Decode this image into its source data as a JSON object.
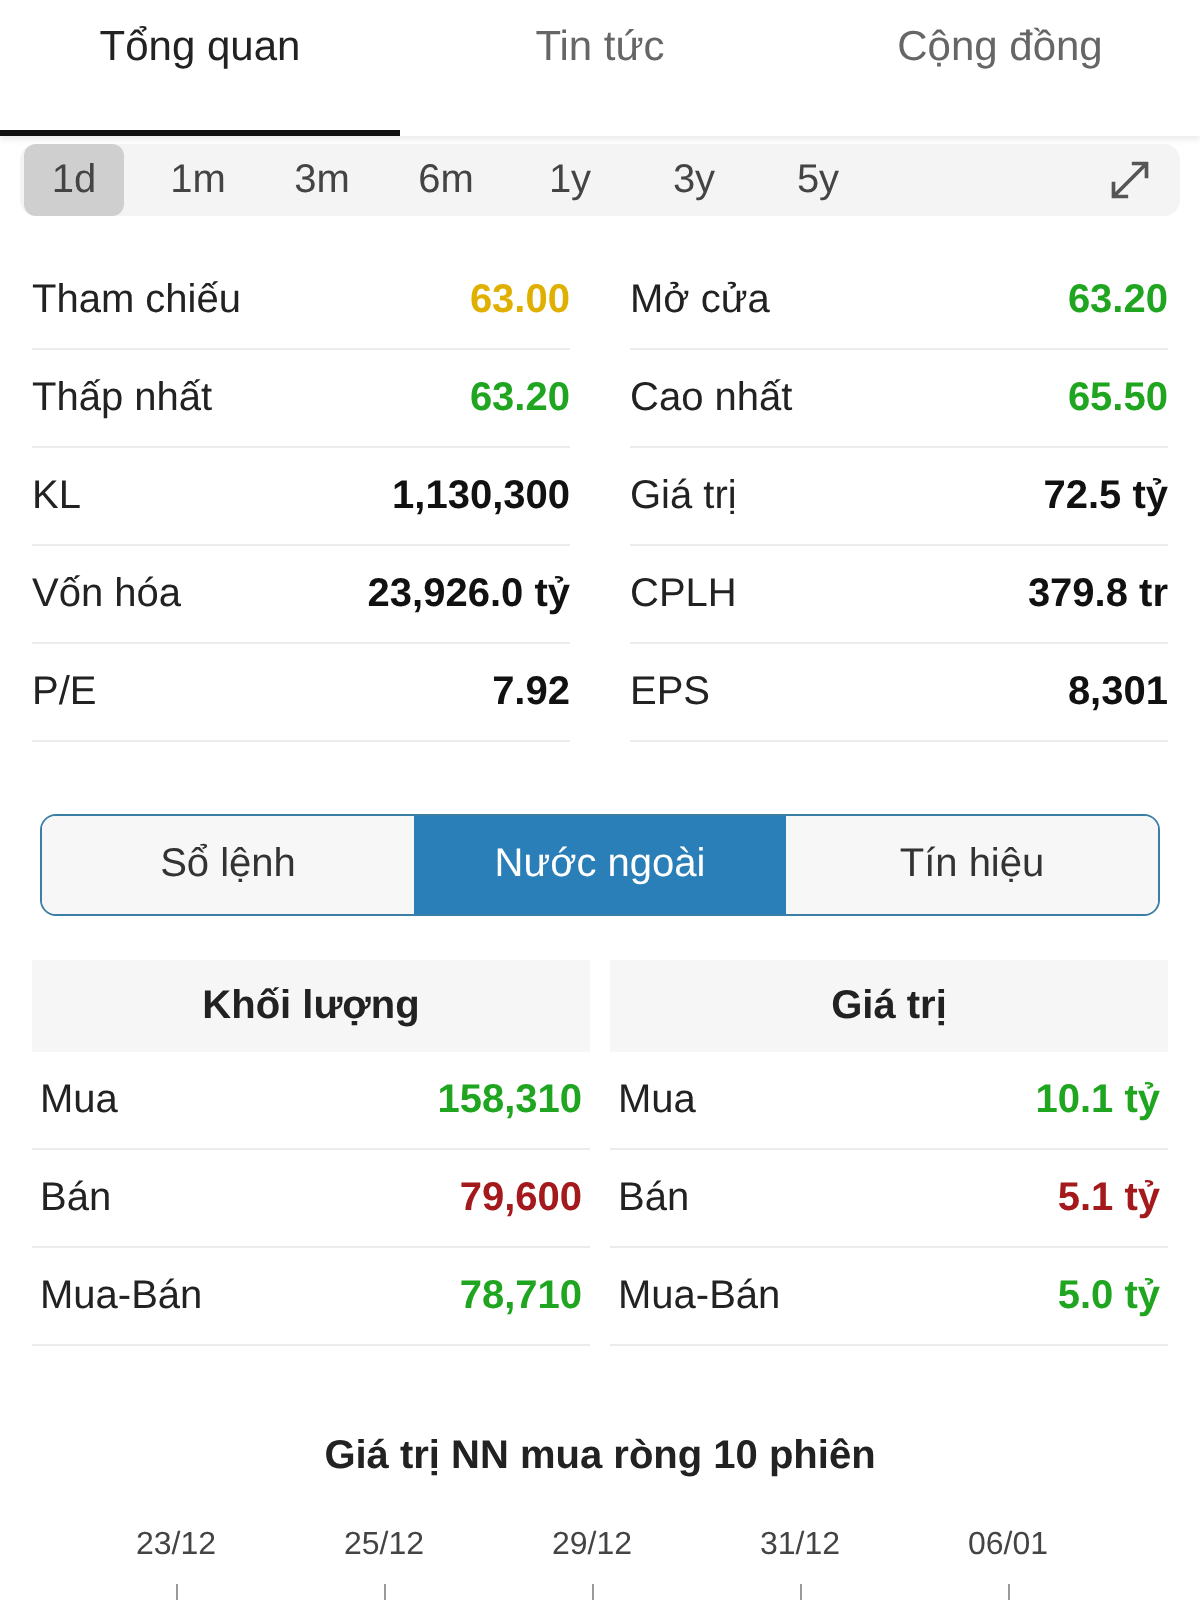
{
  "tabs": [
    {
      "label": "Tổng quan",
      "selected": true
    },
    {
      "label": "Tin tức",
      "selected": false
    },
    {
      "label": "Cộng đồng",
      "selected": false
    }
  ],
  "periods": [
    {
      "label": "1d",
      "selected": true
    },
    {
      "label": "1m",
      "selected": false
    },
    {
      "label": "3m",
      "selected": false
    },
    {
      "label": "6m",
      "selected": false
    },
    {
      "label": "1y",
      "selected": false
    },
    {
      "label": "3y",
      "selected": false
    },
    {
      "label": "5y",
      "selected": false
    }
  ],
  "stats": [
    [
      {
        "label": "Tham chiếu",
        "value": "63.00",
        "color": "#e0b000"
      },
      {
        "label": "Mở cửa",
        "value": "63.20",
        "color": "#1fa51f"
      }
    ],
    [
      {
        "label": "Thấp nhất",
        "value": "63.20",
        "color": "#1fa51f"
      },
      {
        "label": "Cao nhất",
        "value": "65.50",
        "color": "#1fa51f"
      }
    ],
    [
      {
        "label": "KL",
        "value": "1,130,300",
        "color": "#111111"
      },
      {
        "label": "Giá trị",
        "value": "72.5 tỷ",
        "color": "#111111"
      }
    ],
    [
      {
        "label": "Vốn hóa",
        "value": "23,926.0 tỷ",
        "color": "#111111"
      },
      {
        "label": "CPLH",
        "value": "379.8 tr",
        "color": "#111111"
      }
    ],
    [
      {
        "label": "P/E",
        "value": "7.92",
        "color": "#111111"
      },
      {
        "label": "EPS",
        "value": "8,301",
        "color": "#111111"
      }
    ]
  ],
  "segments": [
    {
      "label": "Sổ lệnh",
      "selected": false
    },
    {
      "label": "Nước ngoài",
      "selected": true
    },
    {
      "label": "Tín hiệu",
      "selected": false
    }
  ],
  "foreign_tables": [
    {
      "title": "Khối lượng",
      "rows": [
        {
          "label": "Mua",
          "value": "158,310",
          "color": "#1fa51f"
        },
        {
          "label": "Bán",
          "value": "79,600",
          "color": "#a3191c"
        },
        {
          "label": "Mua-Bán",
          "value": "78,710",
          "color": "#1fa51f"
        }
      ]
    },
    {
      "title": "Giá trị",
      "rows": [
        {
          "label": "Mua",
          "value": "10.1 tỷ",
          "color": "#1fa51f"
        },
        {
          "label": "Bán",
          "value": "5.1 tỷ",
          "color": "#a3191c"
        },
        {
          "label": "Mua-Bán",
          "value": "5.0 tỷ",
          "color": "#1fa51f"
        }
      ]
    }
  ],
  "chart": {
    "title": "Giá trị NN mua ròng 10 phiên",
    "x_labels": [
      "23/12",
      "25/12",
      "29/12",
      "31/12",
      "06/01"
    ]
  }
}
